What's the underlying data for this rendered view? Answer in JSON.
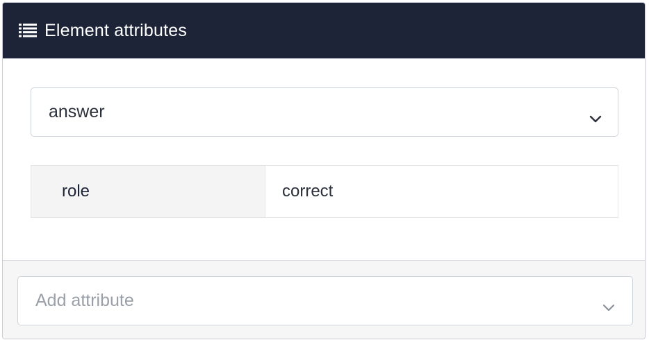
{
  "header": {
    "icon": "list-icon",
    "title": "Element attributes"
  },
  "element_select": {
    "value": "answer",
    "icon": "chevron-down-icon"
  },
  "attributes": [
    {
      "key": "role",
      "value": "correct"
    }
  ],
  "add_attribute": {
    "placeholder": "Add attribute",
    "icon": "chevron-down-icon"
  },
  "colors": {
    "header_bg": "#1d2438",
    "header_text": "#ffffff",
    "key_bg": "#f4f4f4",
    "footer_bg": "#f6f6f7"
  }
}
